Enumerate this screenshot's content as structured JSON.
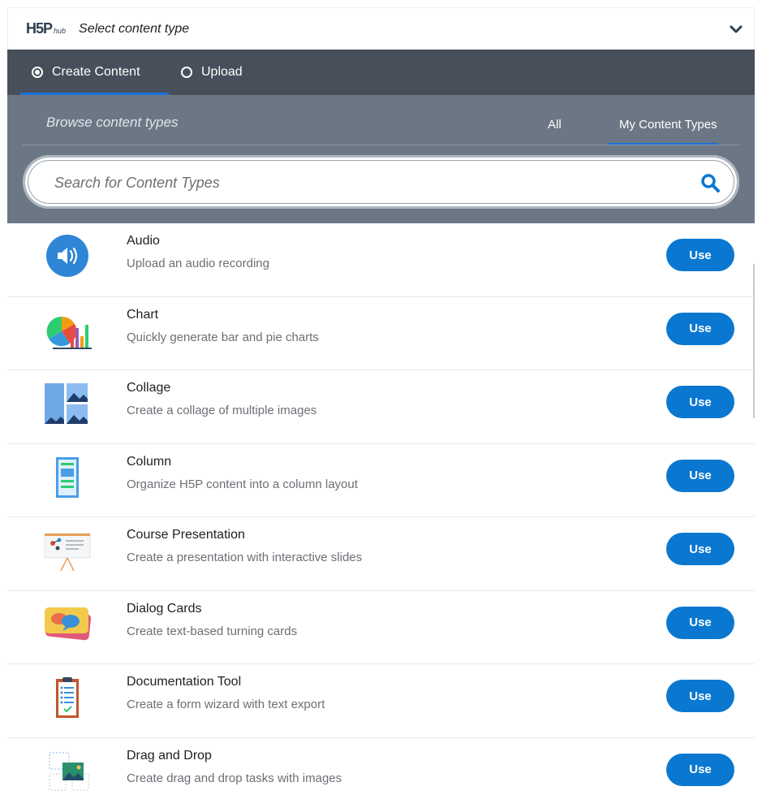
{
  "header": {
    "logo_main": "H5P",
    "logo_sub": "hub",
    "title": "Select content type",
    "toggle_icon": "chevron-down-icon"
  },
  "tabs": [
    {
      "label": "Create Content",
      "selected": true
    },
    {
      "label": "Upload",
      "selected": false
    }
  ],
  "browse": {
    "label": "Browse content types",
    "filters": [
      {
        "label": "All",
        "active": false
      },
      {
        "label": "My Content Types",
        "active": true
      }
    ]
  },
  "search": {
    "placeholder": "Search for Content Types",
    "value": ""
  },
  "content_types": [
    {
      "title": "Audio",
      "description": "Upload an audio recording",
      "icon": "audio-icon",
      "button": "Use"
    },
    {
      "title": "Chart",
      "description": "Quickly generate bar and pie charts",
      "icon": "chart-icon",
      "button": "Use"
    },
    {
      "title": "Collage",
      "description": "Create a collage of multiple images",
      "icon": "collage-icon",
      "button": "Use"
    },
    {
      "title": "Column",
      "description": "Organize H5P content into a column layout",
      "icon": "column-icon",
      "button": "Use"
    },
    {
      "title": "Course Presentation",
      "description": "Create a presentation with interactive slides",
      "icon": "course-presentation-icon",
      "button": "Use"
    },
    {
      "title": "Dialog Cards",
      "description": "Create text-based turning cards",
      "icon": "dialog-cards-icon",
      "button": "Use"
    },
    {
      "title": "Documentation Tool",
      "description": "Create a form wizard with text export",
      "icon": "documentation-tool-icon",
      "button": "Use"
    },
    {
      "title": "Drag and Drop",
      "description": "Create drag and drop tasks with images",
      "icon": "drag-and-drop-icon",
      "button": "Use"
    }
  ],
  "colors": {
    "accent": "#0a78d1",
    "tab_bar": "#474f5a",
    "browse_bar": "#6c7785"
  }
}
